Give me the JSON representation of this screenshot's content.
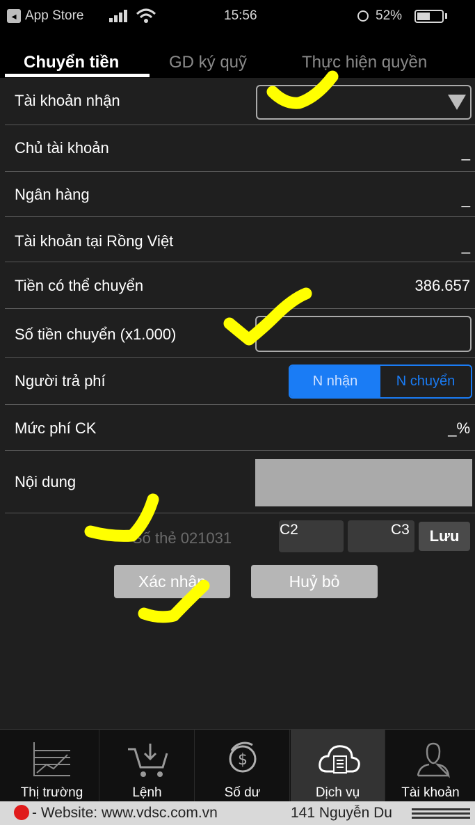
{
  "status_bar": {
    "back_app": "App Store",
    "time": "15:56",
    "battery_percent": "52%",
    "battery_level": 0.52
  },
  "tabs": [
    {
      "label": "Chuyển tiền",
      "active": true
    },
    {
      "label": "GD ký quỹ",
      "active": false
    },
    {
      "label": "Thực hiện quyền",
      "active": false
    }
  ],
  "form": {
    "receiving_account": {
      "label": "Tài khoản nhận",
      "value": ""
    },
    "account_holder": {
      "label": "Chủ tài khoản",
      "value": "_"
    },
    "bank": {
      "label": "Ngân hàng",
      "value": "_"
    },
    "rong_viet_account": {
      "label": "Tài khoản tại Rồng Việt",
      "value": "_"
    },
    "transferable": {
      "label": "Tiền có thể chuyển",
      "value": "386.657"
    },
    "amount": {
      "label": "Số tiền chuyển (x1.000)",
      "value": ""
    },
    "fee_payer": {
      "label": "Người trả phí",
      "options": [
        "N nhận",
        "N chuyển"
      ],
      "selected": "N nhận"
    },
    "fee_rate": {
      "label": "Mức phí CK",
      "value": "_%"
    },
    "content": {
      "label": "Nội dung",
      "value": ""
    }
  },
  "card": {
    "text": "Số thẻ 021031",
    "code1_label": "C2",
    "code2_label": "C3",
    "save_label": "Lưu"
  },
  "buttons": {
    "confirm": "Xác nhận",
    "cancel": "Huỷ bỏ"
  },
  "bottom_nav": [
    {
      "label": "Thị trường",
      "icon": "chart-icon"
    },
    {
      "label": "Lệnh",
      "icon": "cart-icon"
    },
    {
      "label": "Số dư",
      "icon": "dollar-icon"
    },
    {
      "label": "Dịch vụ",
      "icon": "cloud-icon",
      "active": true
    },
    {
      "label": "Tài khoản",
      "icon": "user-icon"
    }
  ],
  "footer": {
    "website": "- Website: www.vdsc.com.vn",
    "address": "141 Nguyễn Du"
  },
  "colors": {
    "accent": "#1a7cf5",
    "annotation": "#ffff00",
    "background": "#1f1f1f"
  }
}
